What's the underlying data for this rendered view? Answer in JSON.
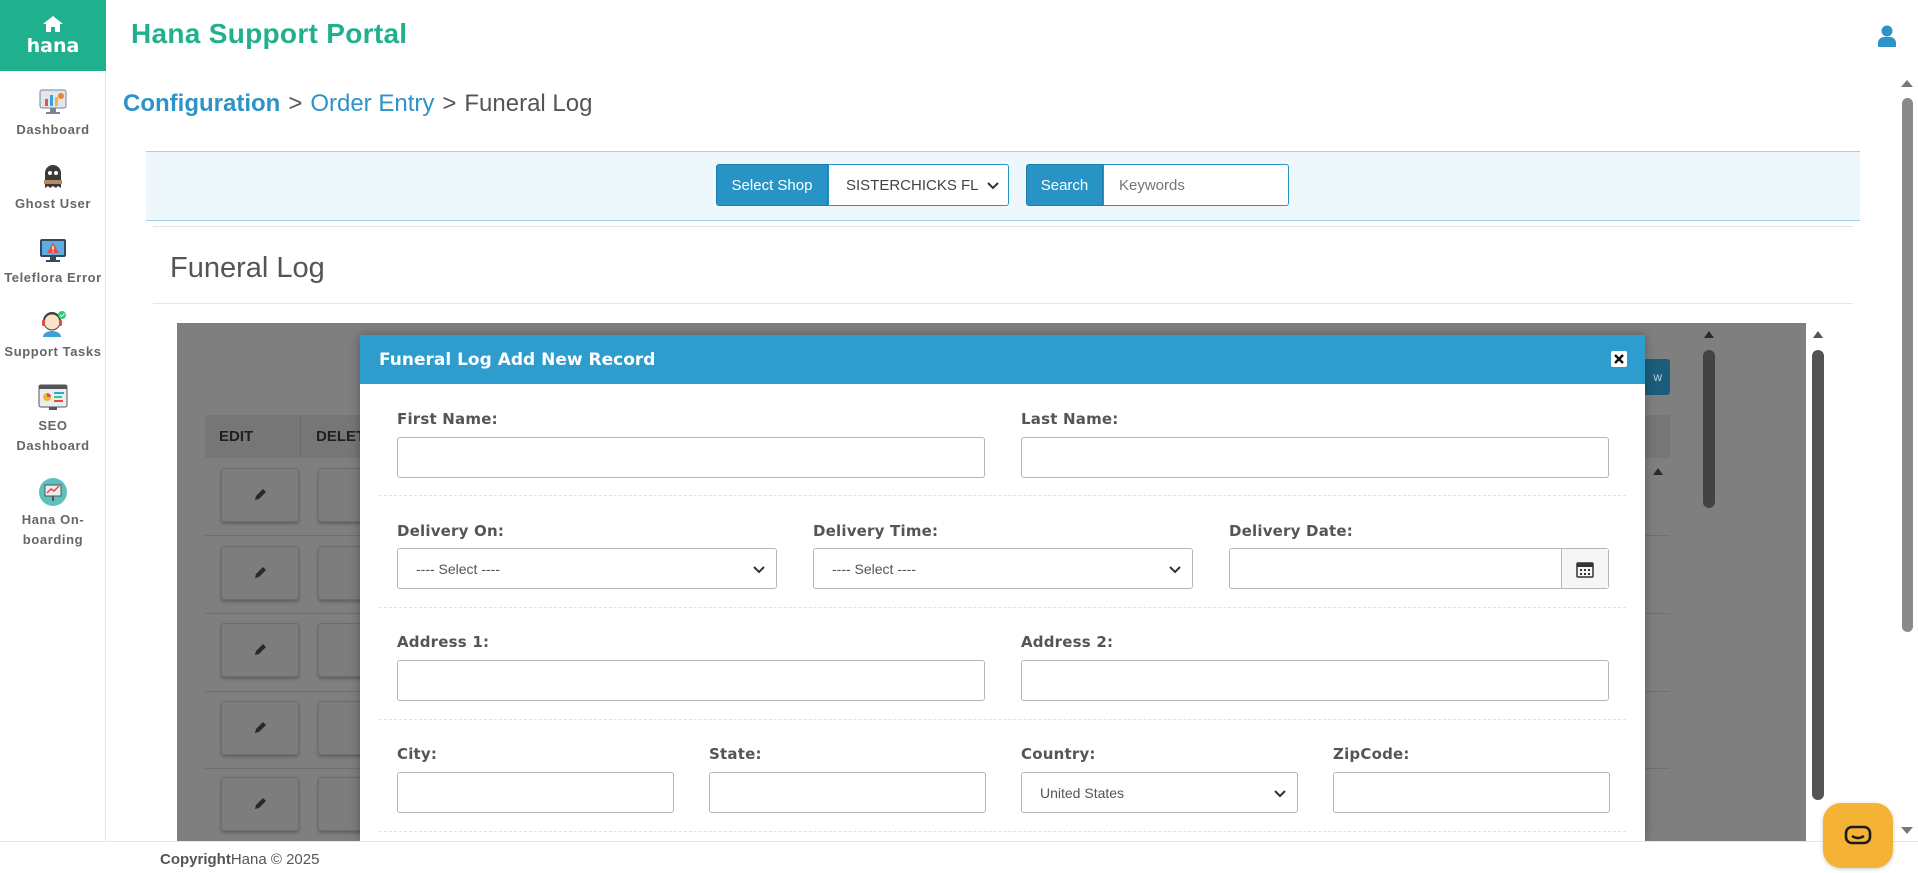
{
  "brand": {
    "name": "hana",
    "home_icon": "home-icon"
  },
  "app_title": "Hana Support Portal",
  "sidebar": {
    "items": [
      {
        "label": "Dashboard",
        "icon": "dashboard-chart-icon"
      },
      {
        "label": "Ghost User",
        "icon": "ghost-user-icon"
      },
      {
        "label": "Teleflora Error",
        "icon": "monitor-warning-icon"
      },
      {
        "label": "Support Tasks",
        "icon": "support-agent-icon"
      },
      {
        "label": "SEO Dashboard",
        "icon": "seo-dashboard-icon"
      },
      {
        "label": "Hana On-boarding",
        "icon": "onboarding-icon"
      }
    ]
  },
  "breadcrumb": {
    "level1": "Configuration",
    "sep1": ">",
    "level2": "Order Entry",
    "sep2": ">",
    "level3": "Funeral Log"
  },
  "filter": {
    "shop_label": "Select Shop",
    "shop_value": "SISTERCHICKS FL",
    "search_label": "Search",
    "search_placeholder": "Keywords"
  },
  "page_heading": "Funeral Log",
  "grid": {
    "headers": [
      "EDIT",
      "DELET"
    ],
    "new_button_fragment": "w"
  },
  "modal": {
    "title": "Funeral Log Add New Record",
    "fields": {
      "first_name": {
        "label": "First Name:",
        "value": ""
      },
      "last_name": {
        "label": "Last Name:",
        "value": ""
      },
      "delivery_on": {
        "label": "Delivery On:",
        "value": "---- Select ----"
      },
      "delivery_time": {
        "label": "Delivery Time:",
        "value": "---- Select ----"
      },
      "delivery_date": {
        "label": "Delivery Date:",
        "value": ""
      },
      "address1": {
        "label": "Address 1:",
        "value": ""
      },
      "address2": {
        "label": "Address 2:",
        "value": ""
      },
      "city": {
        "label": "City:",
        "value": ""
      },
      "state": {
        "label": "State:",
        "value": ""
      },
      "country": {
        "label": "Country:",
        "value": "United States"
      },
      "zipcode": {
        "label": "ZipCode:",
        "value": ""
      }
    }
  },
  "footer": {
    "copyright_bold": "Copyright",
    "copyright_rest": "Hana © 2025"
  },
  "colors": {
    "brand": "#21b08d",
    "accent": "#2e9ccd",
    "chat": "#f4b334"
  }
}
